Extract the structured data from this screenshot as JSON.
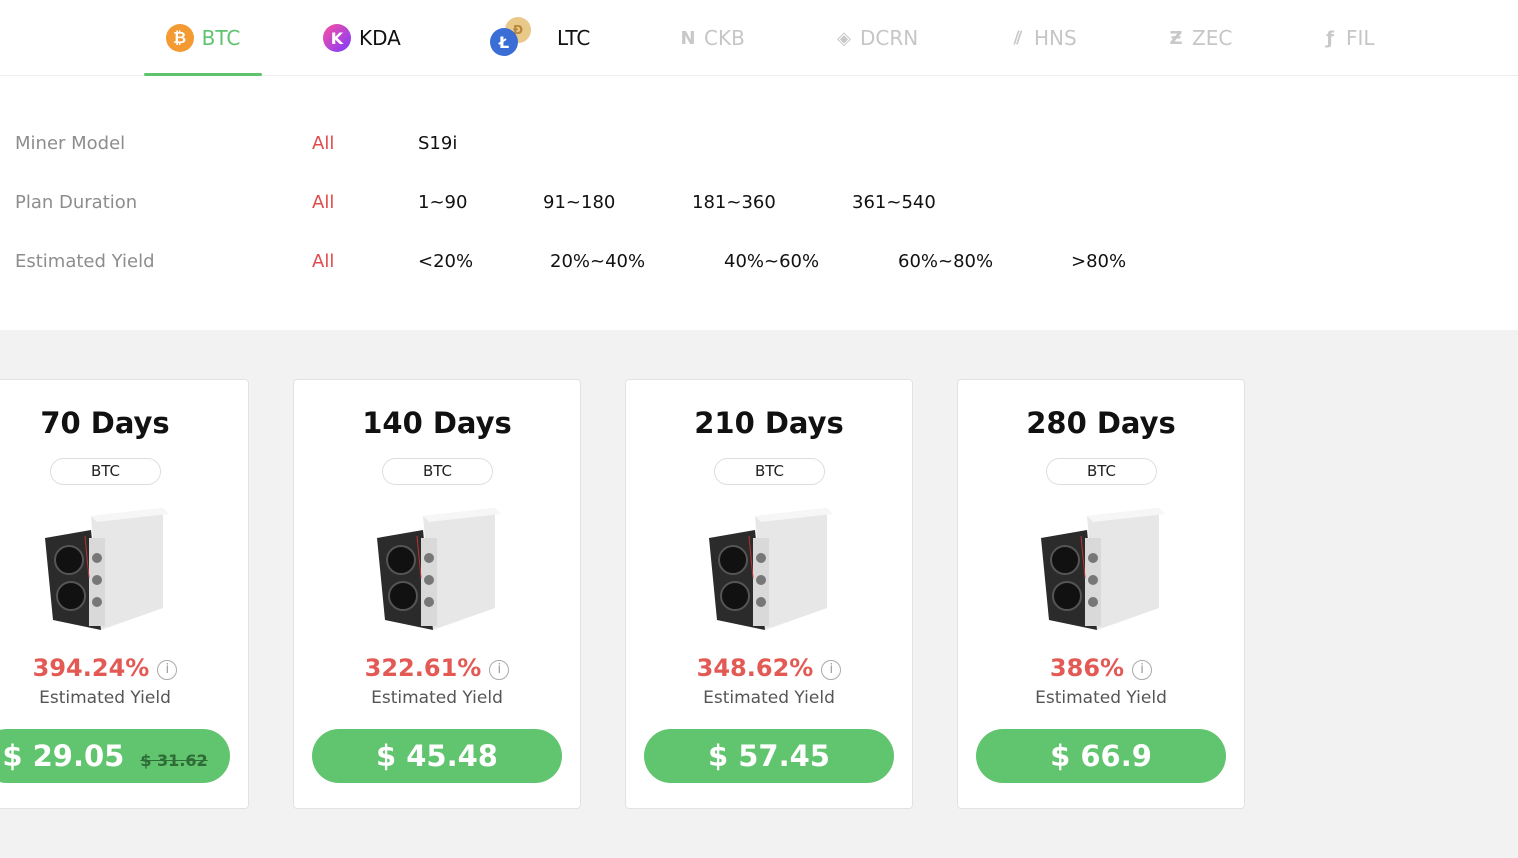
{
  "tabs": [
    {
      "label": "BTC",
      "icon": "bitcoin-icon",
      "state": "active"
    },
    {
      "label": "KDA",
      "icon": "kadena-icon",
      "state": "dark"
    },
    {
      "label": "LTC",
      "icon": "litecoin-icon",
      "state": "dark"
    },
    {
      "label": "CKB",
      "icon": "nervos-icon",
      "state": "disabled"
    },
    {
      "label": "DCRN",
      "icon": "decred-icon",
      "state": "disabled"
    },
    {
      "label": "HNS",
      "icon": "handshake-icon",
      "state": "disabled"
    },
    {
      "label": "ZEC",
      "icon": "zcash-icon",
      "state": "disabled"
    },
    {
      "label": "FIL",
      "icon": "filecoin-icon",
      "state": "disabled"
    }
  ],
  "filters": {
    "miner_model": {
      "label": "Miner Model",
      "options": [
        "All",
        "S19i"
      ]
    },
    "plan_duration": {
      "label": "Plan Duration",
      "options": [
        "All",
        "1~90",
        "91~180",
        "181~360",
        "361~540"
      ]
    },
    "estimated_yield": {
      "label": "Estimated Yield",
      "options": [
        "All",
        "<20%",
        "20%~40%",
        "40%~60%",
        "60%~80%",
        ">80%"
      ]
    }
  },
  "cards": [
    {
      "title": "70 Days",
      "coin": "BTC",
      "yield": "394.24%",
      "yield_label": "Estimated Yield",
      "price": "$ 29.05",
      "old_price": "$ 31.62"
    },
    {
      "title": "140 Days",
      "coin": "BTC",
      "yield": "322.61%",
      "yield_label": "Estimated Yield",
      "price": "$ 45.48",
      "old_price": ""
    },
    {
      "title": "210 Days",
      "coin": "BTC",
      "yield": "348.62%",
      "yield_label": "Estimated Yield",
      "price": "$ 57.45",
      "old_price": ""
    },
    {
      "title": "280 Days",
      "coin": "BTC",
      "yield": "386%",
      "yield_label": "Estimated Yield",
      "price": "$ 66.9",
      "old_price": ""
    }
  ],
  "colors": {
    "accent_green": "#5ec36e",
    "selected_red": "#e14b4b",
    "yield_red": "#e35a55",
    "button_green": "#61c46e"
  }
}
